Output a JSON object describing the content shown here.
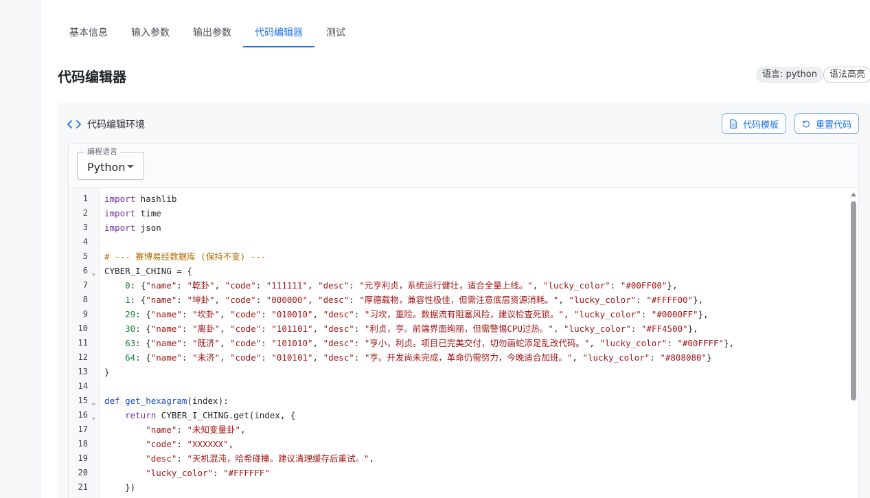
{
  "tabs": [
    {
      "label": "基本信息",
      "active": false
    },
    {
      "label": "输入参数",
      "active": false
    },
    {
      "label": "输出参数",
      "active": false
    },
    {
      "label": "代码编辑器",
      "active": true
    },
    {
      "label": "测试",
      "active": false
    }
  ],
  "page": {
    "title": "代码编辑器",
    "language_chip": "语言: python",
    "highlight_chip": "语法高亮"
  },
  "card": {
    "title": "代码编辑环境",
    "template_button": "代码模板",
    "reset_button": "重置代码"
  },
  "language_select": {
    "label": "编程语言",
    "value": "Python"
  },
  "editor": {
    "lines": [
      {
        "n": "1",
        "fold": false,
        "tokens": [
          {
            "t": "import",
            "c": "#7a2fa3"
          },
          {
            "t": " hashlib",
            "c": "#1f2328"
          }
        ]
      },
      {
        "n": "2",
        "fold": false,
        "tokens": [
          {
            "t": "import",
            "c": "#7a2fa3"
          },
          {
            "t": " time",
            "c": "#1f2328"
          }
        ]
      },
      {
        "n": "3",
        "fold": false,
        "tokens": [
          {
            "t": "import",
            "c": "#7a2fa3"
          },
          {
            "t": " json",
            "c": "#1f2328"
          }
        ]
      },
      {
        "n": "4",
        "fold": false,
        "tokens": []
      },
      {
        "n": "5",
        "fold": false,
        "tokens": [
          {
            "t": "# --- 赛博易经数据库 (保持不变) ---",
            "c": "#b26a00"
          }
        ]
      },
      {
        "n": "6",
        "fold": true,
        "tokens": [
          {
            "t": "CYBER_I_CHING = {",
            "c": "#1f2328"
          }
        ]
      },
      {
        "n": "7",
        "fold": false,
        "tokens": [
          {
            "t": "    ",
            "c": "#1f2328"
          },
          {
            "t": "0",
            "c": "#1b7f3a"
          },
          {
            "t": ": {",
            "c": "#1f2328"
          },
          {
            "t": "\"name\"",
            "c": "#a31515"
          },
          {
            "t": ": ",
            "c": "#1f2328"
          },
          {
            "t": "\"乾卦\"",
            "c": "#a31515"
          },
          {
            "t": ", ",
            "c": "#1f2328"
          },
          {
            "t": "\"code\"",
            "c": "#a31515"
          },
          {
            "t": ": ",
            "c": "#1f2328"
          },
          {
            "t": "\"111111\"",
            "c": "#a31515"
          },
          {
            "t": ", ",
            "c": "#1f2328"
          },
          {
            "t": "\"desc\"",
            "c": "#a31515"
          },
          {
            "t": ": ",
            "c": "#1f2328"
          },
          {
            "t": "\"元亨利贞，系统运行健壮，适合全量上线。\"",
            "c": "#a31515"
          },
          {
            "t": ", ",
            "c": "#1f2328"
          },
          {
            "t": "\"lucky_color\"",
            "c": "#a31515"
          },
          {
            "t": ": ",
            "c": "#1f2328"
          },
          {
            "t": "\"#00FF00\"",
            "c": "#a31515"
          },
          {
            "t": "},",
            "c": "#1f2328"
          }
        ]
      },
      {
        "n": "8",
        "fold": false,
        "tokens": [
          {
            "t": "    ",
            "c": "#1f2328"
          },
          {
            "t": "1",
            "c": "#1b7f3a"
          },
          {
            "t": ": {",
            "c": "#1f2328"
          },
          {
            "t": "\"name\"",
            "c": "#a31515"
          },
          {
            "t": ": ",
            "c": "#1f2328"
          },
          {
            "t": "\"坤卦\"",
            "c": "#a31515"
          },
          {
            "t": ", ",
            "c": "#1f2328"
          },
          {
            "t": "\"code\"",
            "c": "#a31515"
          },
          {
            "t": ": ",
            "c": "#1f2328"
          },
          {
            "t": "\"000000\"",
            "c": "#a31515"
          },
          {
            "t": ", ",
            "c": "#1f2328"
          },
          {
            "t": "\"desc\"",
            "c": "#a31515"
          },
          {
            "t": ": ",
            "c": "#1f2328"
          },
          {
            "t": "\"厚德载物，兼容性极佳，但需注意底层资源消耗。\"",
            "c": "#a31515"
          },
          {
            "t": ", ",
            "c": "#1f2328"
          },
          {
            "t": "\"lucky_color\"",
            "c": "#a31515"
          },
          {
            "t": ": ",
            "c": "#1f2328"
          },
          {
            "t": "\"#FFFF00\"",
            "c": "#a31515"
          },
          {
            "t": "},",
            "c": "#1f2328"
          }
        ]
      },
      {
        "n": "9",
        "fold": false,
        "tokens": [
          {
            "t": "    ",
            "c": "#1f2328"
          },
          {
            "t": "29",
            "c": "#1b7f3a"
          },
          {
            "t": ": {",
            "c": "#1f2328"
          },
          {
            "t": "\"name\"",
            "c": "#a31515"
          },
          {
            "t": ": ",
            "c": "#1f2328"
          },
          {
            "t": "\"坎卦\"",
            "c": "#a31515"
          },
          {
            "t": ", ",
            "c": "#1f2328"
          },
          {
            "t": "\"code\"",
            "c": "#a31515"
          },
          {
            "t": ": ",
            "c": "#1f2328"
          },
          {
            "t": "\"010010\"",
            "c": "#a31515"
          },
          {
            "t": ", ",
            "c": "#1f2328"
          },
          {
            "t": "\"desc\"",
            "c": "#a31515"
          },
          {
            "t": ": ",
            "c": "#1f2328"
          },
          {
            "t": "\"习坎，重险。数据流有阻塞风险，建议检查死锁。\"",
            "c": "#a31515"
          },
          {
            "t": ", ",
            "c": "#1f2328"
          },
          {
            "t": "\"lucky_color\"",
            "c": "#a31515"
          },
          {
            "t": ": ",
            "c": "#1f2328"
          },
          {
            "t": "\"#0000FF\"",
            "c": "#a31515"
          },
          {
            "t": "},",
            "c": "#1f2328"
          }
        ]
      },
      {
        "n": "10",
        "fold": false,
        "tokens": [
          {
            "t": "    ",
            "c": "#1f2328"
          },
          {
            "t": "30",
            "c": "#1b7f3a"
          },
          {
            "t": ": {",
            "c": "#1f2328"
          },
          {
            "t": "\"name\"",
            "c": "#a31515"
          },
          {
            "t": ": ",
            "c": "#1f2328"
          },
          {
            "t": "\"离卦\"",
            "c": "#a31515"
          },
          {
            "t": ", ",
            "c": "#1f2328"
          },
          {
            "t": "\"code\"",
            "c": "#a31515"
          },
          {
            "t": ": ",
            "c": "#1f2328"
          },
          {
            "t": "\"101101\"",
            "c": "#a31515"
          },
          {
            "t": ", ",
            "c": "#1f2328"
          },
          {
            "t": "\"desc\"",
            "c": "#a31515"
          },
          {
            "t": ": ",
            "c": "#1f2328"
          },
          {
            "t": "\"利贞，亨。前端界面绚丽，但需警惕CPU过热。\"",
            "c": "#a31515"
          },
          {
            "t": ", ",
            "c": "#1f2328"
          },
          {
            "t": "\"lucky_color\"",
            "c": "#a31515"
          },
          {
            "t": ": ",
            "c": "#1f2328"
          },
          {
            "t": "\"#FF4500\"",
            "c": "#a31515"
          },
          {
            "t": "},",
            "c": "#1f2328"
          }
        ]
      },
      {
        "n": "11",
        "fold": false,
        "tokens": [
          {
            "t": "    ",
            "c": "#1f2328"
          },
          {
            "t": "63",
            "c": "#1b7f3a"
          },
          {
            "t": ": {",
            "c": "#1f2328"
          },
          {
            "t": "\"name\"",
            "c": "#a31515"
          },
          {
            "t": ": ",
            "c": "#1f2328"
          },
          {
            "t": "\"既济\"",
            "c": "#a31515"
          },
          {
            "t": ", ",
            "c": "#1f2328"
          },
          {
            "t": "\"code\"",
            "c": "#a31515"
          },
          {
            "t": ": ",
            "c": "#1f2328"
          },
          {
            "t": "\"101010\"",
            "c": "#a31515"
          },
          {
            "t": ", ",
            "c": "#1f2328"
          },
          {
            "t": "\"desc\"",
            "c": "#a31515"
          },
          {
            "t": ": ",
            "c": "#1f2328"
          },
          {
            "t": "\"亨小，利贞。项目已完美交付，切勿画蛇添足乱改代码。\"",
            "c": "#a31515"
          },
          {
            "t": ", ",
            "c": "#1f2328"
          },
          {
            "t": "\"lucky_color\"",
            "c": "#a31515"
          },
          {
            "t": ": ",
            "c": "#1f2328"
          },
          {
            "t": "\"#00FFFF\"",
            "c": "#a31515"
          },
          {
            "t": "},",
            "c": "#1f2328"
          }
        ]
      },
      {
        "n": "12",
        "fold": false,
        "tokens": [
          {
            "t": "    ",
            "c": "#1f2328"
          },
          {
            "t": "64",
            "c": "#1b7f3a"
          },
          {
            "t": ": {",
            "c": "#1f2328"
          },
          {
            "t": "\"name\"",
            "c": "#a31515"
          },
          {
            "t": ": ",
            "c": "#1f2328"
          },
          {
            "t": "\"未济\"",
            "c": "#a31515"
          },
          {
            "t": ", ",
            "c": "#1f2328"
          },
          {
            "t": "\"code\"",
            "c": "#a31515"
          },
          {
            "t": ": ",
            "c": "#1f2328"
          },
          {
            "t": "\"010101\"",
            "c": "#a31515"
          },
          {
            "t": ", ",
            "c": "#1f2328"
          },
          {
            "t": "\"desc\"",
            "c": "#a31515"
          },
          {
            "t": ": ",
            "c": "#1f2328"
          },
          {
            "t": "\"亨。开发尚未完成，革命仍需努力，今晚适合加班。\"",
            "c": "#a31515"
          },
          {
            "t": ", ",
            "c": "#1f2328"
          },
          {
            "t": "\"lucky_color\"",
            "c": "#a31515"
          },
          {
            "t": ": ",
            "c": "#1f2328"
          },
          {
            "t": "\"#808080\"",
            "c": "#a31515"
          },
          {
            "t": "}",
            "c": "#1f2328"
          }
        ]
      },
      {
        "n": "13",
        "fold": false,
        "tokens": [
          {
            "t": "}",
            "c": "#1f2328"
          }
        ]
      },
      {
        "n": "14",
        "fold": false,
        "tokens": []
      },
      {
        "n": "15",
        "fold": true,
        "tokens": [
          {
            "t": "def",
            "c": "#1f3fbf"
          },
          {
            "t": " ",
            "c": "#1f2328"
          },
          {
            "t": "get_hexagram",
            "c": "#1a4fc4"
          },
          {
            "t": "(index):",
            "c": "#1f2328"
          }
        ]
      },
      {
        "n": "16",
        "fold": true,
        "tokens": [
          {
            "t": "    ",
            "c": "#1f2328"
          },
          {
            "t": "return",
            "c": "#7a2fa3"
          },
          {
            "t": " CYBER_I_CHING.get(index, {",
            "c": "#1f2328"
          }
        ]
      },
      {
        "n": "17",
        "fold": false,
        "tokens": [
          {
            "t": "        ",
            "c": "#1f2328"
          },
          {
            "t": "\"name\"",
            "c": "#a31515"
          },
          {
            "t": ": ",
            "c": "#1f2328"
          },
          {
            "t": "\"未知变量卦\"",
            "c": "#a31515"
          },
          {
            "t": ",",
            "c": "#1f2328"
          }
        ]
      },
      {
        "n": "18",
        "fold": false,
        "tokens": [
          {
            "t": "        ",
            "c": "#1f2328"
          },
          {
            "t": "\"code\"",
            "c": "#a31515"
          },
          {
            "t": ": ",
            "c": "#1f2328"
          },
          {
            "t": "\"XXXXXX\"",
            "c": "#a31515"
          },
          {
            "t": ",",
            "c": "#1f2328"
          }
        ]
      },
      {
        "n": "19",
        "fold": false,
        "tokens": [
          {
            "t": "        ",
            "c": "#1f2328"
          },
          {
            "t": "\"desc\"",
            "c": "#a31515"
          },
          {
            "t": ": ",
            "c": "#1f2328"
          },
          {
            "t": "\"天机混沌，哈希碰撞。建议清理缓存后重试。\"",
            "c": "#a31515"
          },
          {
            "t": ",",
            "c": "#1f2328"
          }
        ]
      },
      {
        "n": "20",
        "fold": false,
        "tokens": [
          {
            "t": "        ",
            "c": "#1f2328"
          },
          {
            "t": "\"lucky_color\"",
            "c": "#a31515"
          },
          {
            "t": ": ",
            "c": "#1f2328"
          },
          {
            "t": "\"#FFFFFF\"",
            "c": "#a31515"
          }
        ]
      },
      {
        "n": "21",
        "fold": false,
        "tokens": [
          {
            "t": "    })",
            "c": "#1f2328"
          }
        ]
      }
    ]
  },
  "colors": {
    "accent": "#1a73e8",
    "keyword": "#7a2fa3",
    "string": "#a31515",
    "number": "#1b7f3a",
    "comment": "#b26a00",
    "function": "#1a4fc4"
  }
}
